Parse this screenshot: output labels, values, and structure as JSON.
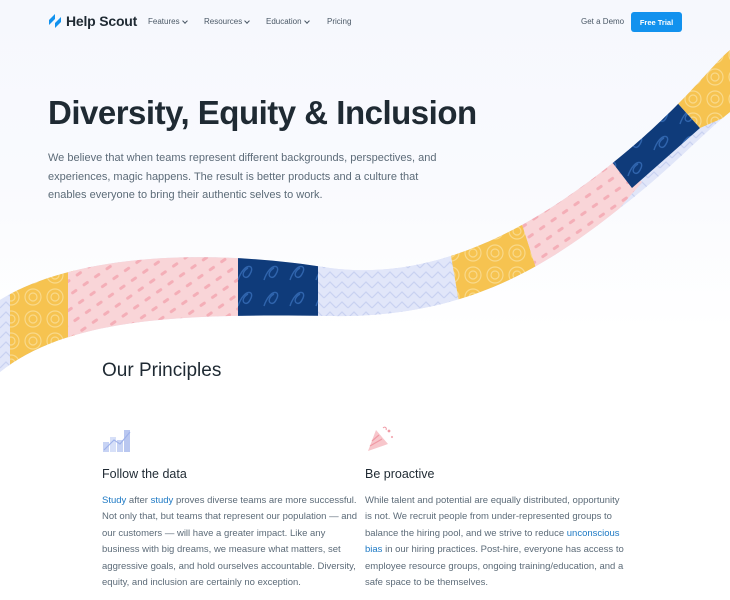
{
  "brand": {
    "name": "Help Scout",
    "accent": "#1292ee",
    "link_color": "#1d79c4",
    "navy": "#0f3b7a",
    "yellow": "#f6c350",
    "pink": "#f9d3d6",
    "lavender": "#dfe5fa"
  },
  "nav": {
    "items": [
      {
        "label": "Features",
        "icon": "chevron-down-icon"
      },
      {
        "label": "Resources",
        "icon": "chevron-down-icon"
      },
      {
        "label": "Education",
        "icon": "chevron-down-icon"
      },
      {
        "label": "Pricing"
      }
    ],
    "demo_label": "Get a Demo",
    "trial_label": "Free Trial"
  },
  "hero": {
    "title": "Diversity, Equity & Inclusion",
    "subtitle": "We believe that when teams represent different backgrounds, perspectives, and experiences, magic happens. The result is better products and a culture that enables everyone to bring their authentic selves to work."
  },
  "principles": {
    "title": "Our Principles",
    "cards": [
      {
        "icon": "bar-chart-icon",
        "title": "Follow the data",
        "link1": "Study",
        "text1": " after ",
        "link2": "study",
        "text2": " proves diverse teams are more successful. Not only that, but teams that represent our population — and our customers — will have a greater impact. Like any business with big dreams, we measure what matters, set aggressive goals, and hold ourselves accountable. Diversity, equity, and inclusion are certainly no exception."
      },
      {
        "icon": "party-hat-icon",
        "title": "Be proactive",
        "text1": "While talent and potential are equally distributed, opportunity is not. We recruit people from under-represented groups to balance the hiring pool, and we strive to reduce ",
        "link1": "unconscious bias",
        "text2": " in our hiring practices. Post-hire, everyone has access to employee resource groups, ongoing training/education, and a safe space to be themselves."
      }
    ]
  }
}
